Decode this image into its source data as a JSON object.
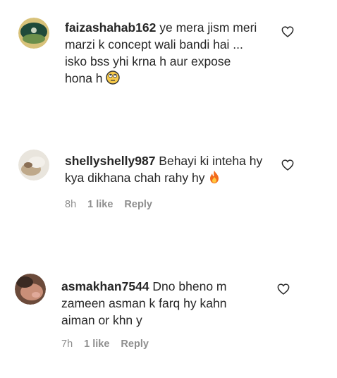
{
  "comments": [
    {
      "username": "faizashahab162",
      "lines": [
        "ye mera jism meri",
        "marzi k concept wali bandi hai ...",
        "isko bss yhi krna h aur expose",
        "hona h"
      ],
      "emoji": "rolling-eyes-emoji",
      "time": "",
      "likes": "",
      "reply": ""
    },
    {
      "username": "shellyshelly987",
      "lines": [
        "Behayi ki inteha hy",
        "kya dikhana chah rahy hy"
      ],
      "emoji": "fire-emoji",
      "time": "8h",
      "likes": "1 like",
      "reply": "Reply"
    },
    {
      "username": "asmakhan7544",
      "lines": [
        "Dno bheno m",
        "zameen asman k farq hy kahn",
        "aiman or khn y"
      ],
      "emoji": "",
      "time": "7h",
      "likes": "1 like",
      "reply": "Reply"
    }
  ]
}
